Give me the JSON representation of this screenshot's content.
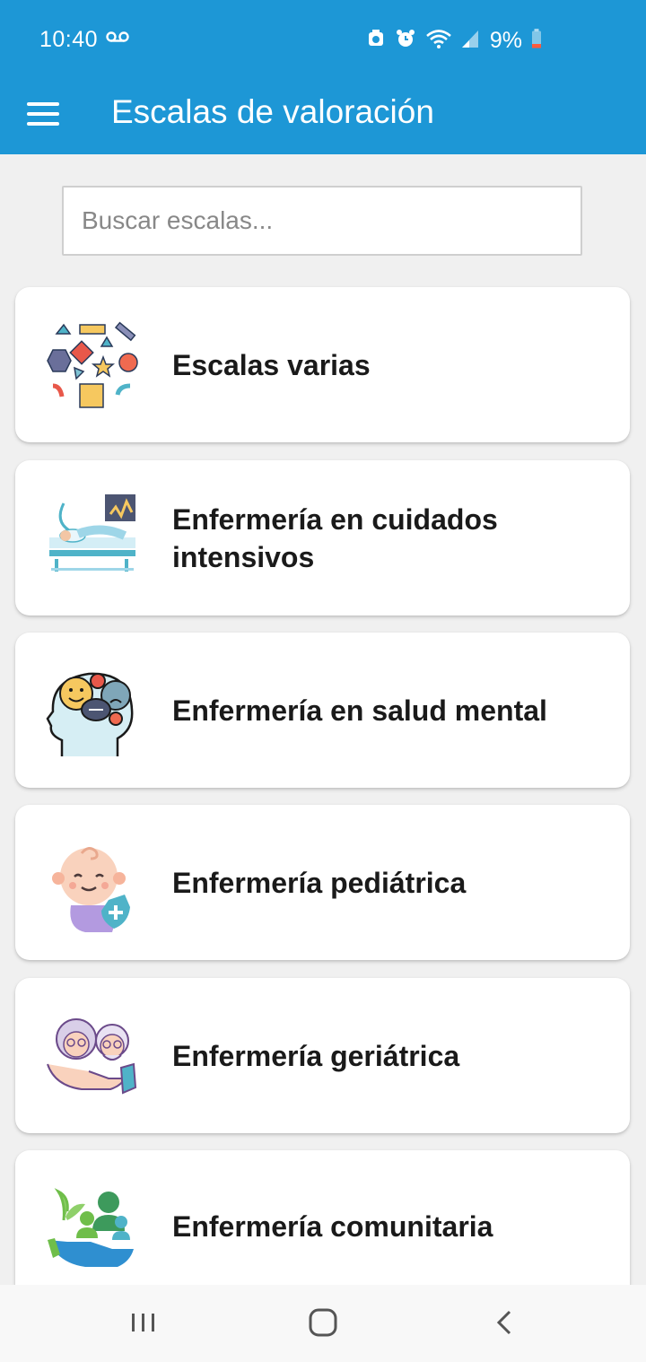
{
  "status_bar": {
    "time": "10:40",
    "battery": "9%",
    "icons": [
      "voicemail-icon",
      "alarm-icon",
      "wifi-icon",
      "signal-icon",
      "battery-icon"
    ]
  },
  "toolbar": {
    "menu_icon": "hamburger-menu-icon",
    "title": "Escalas de valoración"
  },
  "search": {
    "placeholder": "Buscar escalas...",
    "value": ""
  },
  "categories": [
    {
      "label": "Escalas varias",
      "icon": "shapes-icon"
    },
    {
      "label": "Enfermería en cuidados intensivos",
      "icon": "icu-bed-icon"
    },
    {
      "label": "Enfermería en salud mental",
      "icon": "mental-health-head-icon"
    },
    {
      "label": "Enfermería pediátrica",
      "icon": "baby-icon"
    },
    {
      "label": "Enfermería geriátrica",
      "icon": "elderly-couple-icon"
    },
    {
      "label": "Enfermería comunitaria",
      "icon": "community-care-icon"
    }
  ],
  "nav_bar": {
    "icons": [
      "recent-apps-icon",
      "home-icon",
      "back-icon"
    ]
  },
  "colors": {
    "app_bar": "#1d97d6",
    "background": "#f0f0f0"
  }
}
